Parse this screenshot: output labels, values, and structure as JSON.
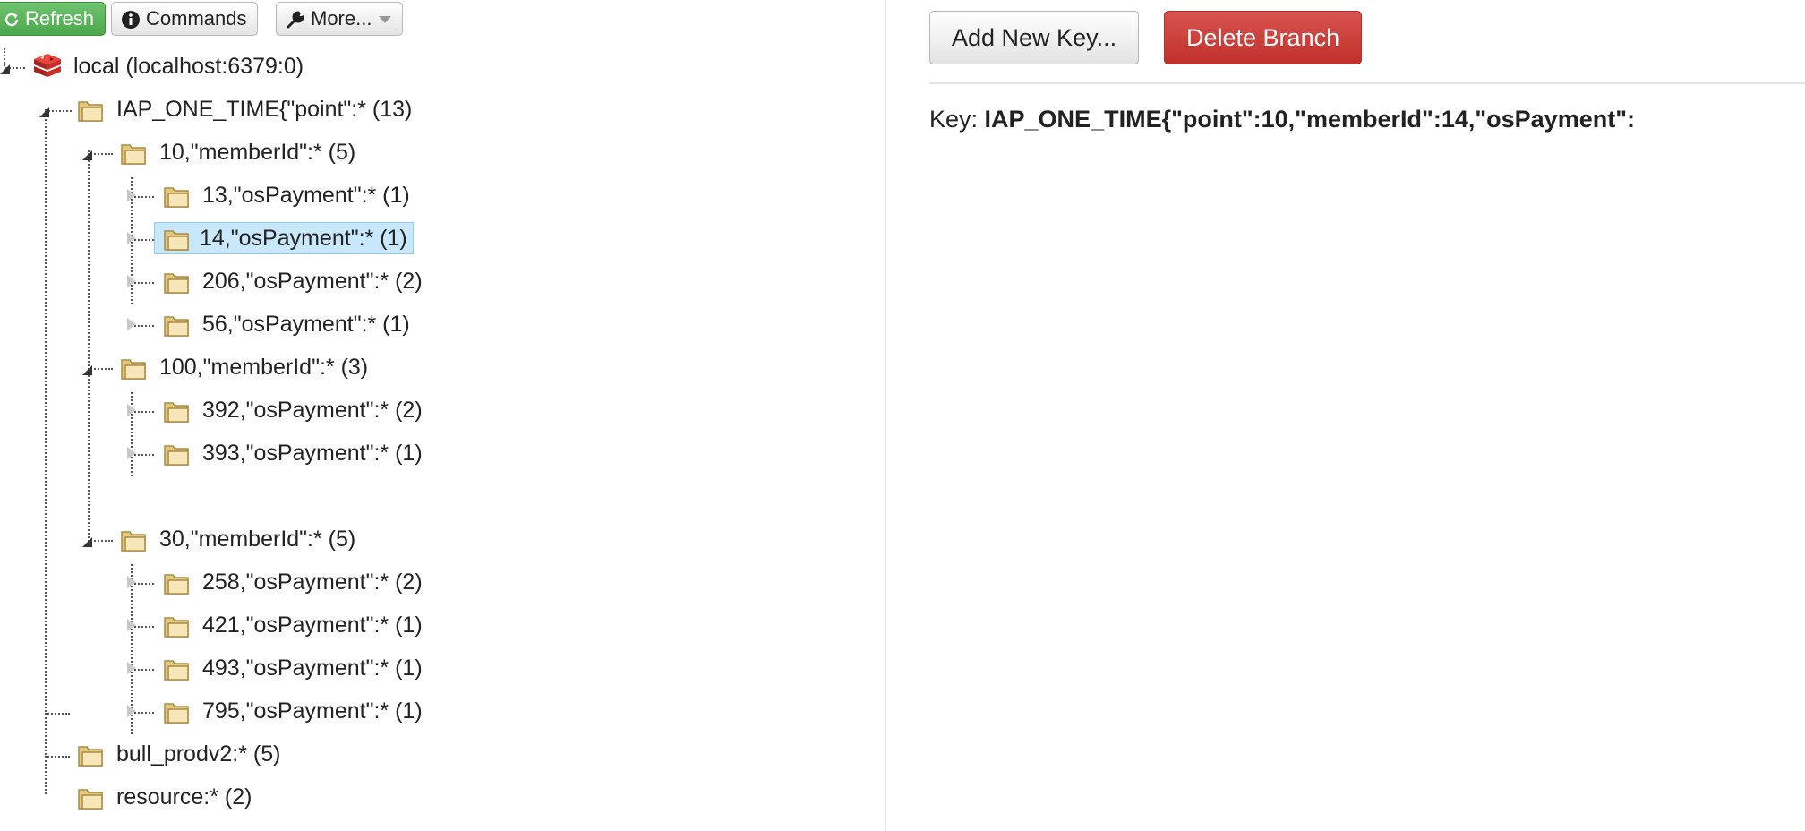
{
  "toolbar": {
    "refresh_label": "Refresh",
    "commands_label": "Commands",
    "more_label": "More..."
  },
  "tree": {
    "root": {
      "label": "local (localhost:6379:0)"
    },
    "nodes": [
      {
        "label": "IAP_ONE_TIME{\"point\":* (13)"
      },
      {
        "label": "10,\"memberId\":* (5)"
      },
      {
        "label": "13,\"osPayment\":* (1)"
      },
      {
        "label": "14,\"osPayment\":* (1)"
      },
      {
        "label": "206,\"osPayment\":* (2)"
      },
      {
        "label": "56,\"osPayment\":* (1)"
      },
      {
        "label": "100,\"memberId\":* (3)"
      },
      {
        "label": "392,\"osPayment\":* (2)"
      },
      {
        "label": "393,\"osPayment\":* (1)"
      },
      {
        "label": "30,\"memberId\":* (5)"
      },
      {
        "label": "258,\"osPayment\":* (2)"
      },
      {
        "label": "421,\"osPayment\":* (1)"
      },
      {
        "label": "493,\"osPayment\":* (1)"
      },
      {
        "label": "795,\"osPayment\":* (1)"
      },
      {
        "label": "bull_prodv2:* (5)"
      },
      {
        "label": "resource:* (2)"
      }
    ]
  },
  "detail": {
    "add_key_label": "Add New Key...",
    "delete_branch_label": "Delete Branch",
    "key_prefix": "Key: ",
    "key_value": "IAP_ONE_TIME{\"point\":10,\"memberId\":14,\"osPayment\":"
  },
  "colors": {
    "refresh_green": "#5cb85c",
    "delete_red": "#d9534f",
    "selection": "#c9e8fb"
  }
}
